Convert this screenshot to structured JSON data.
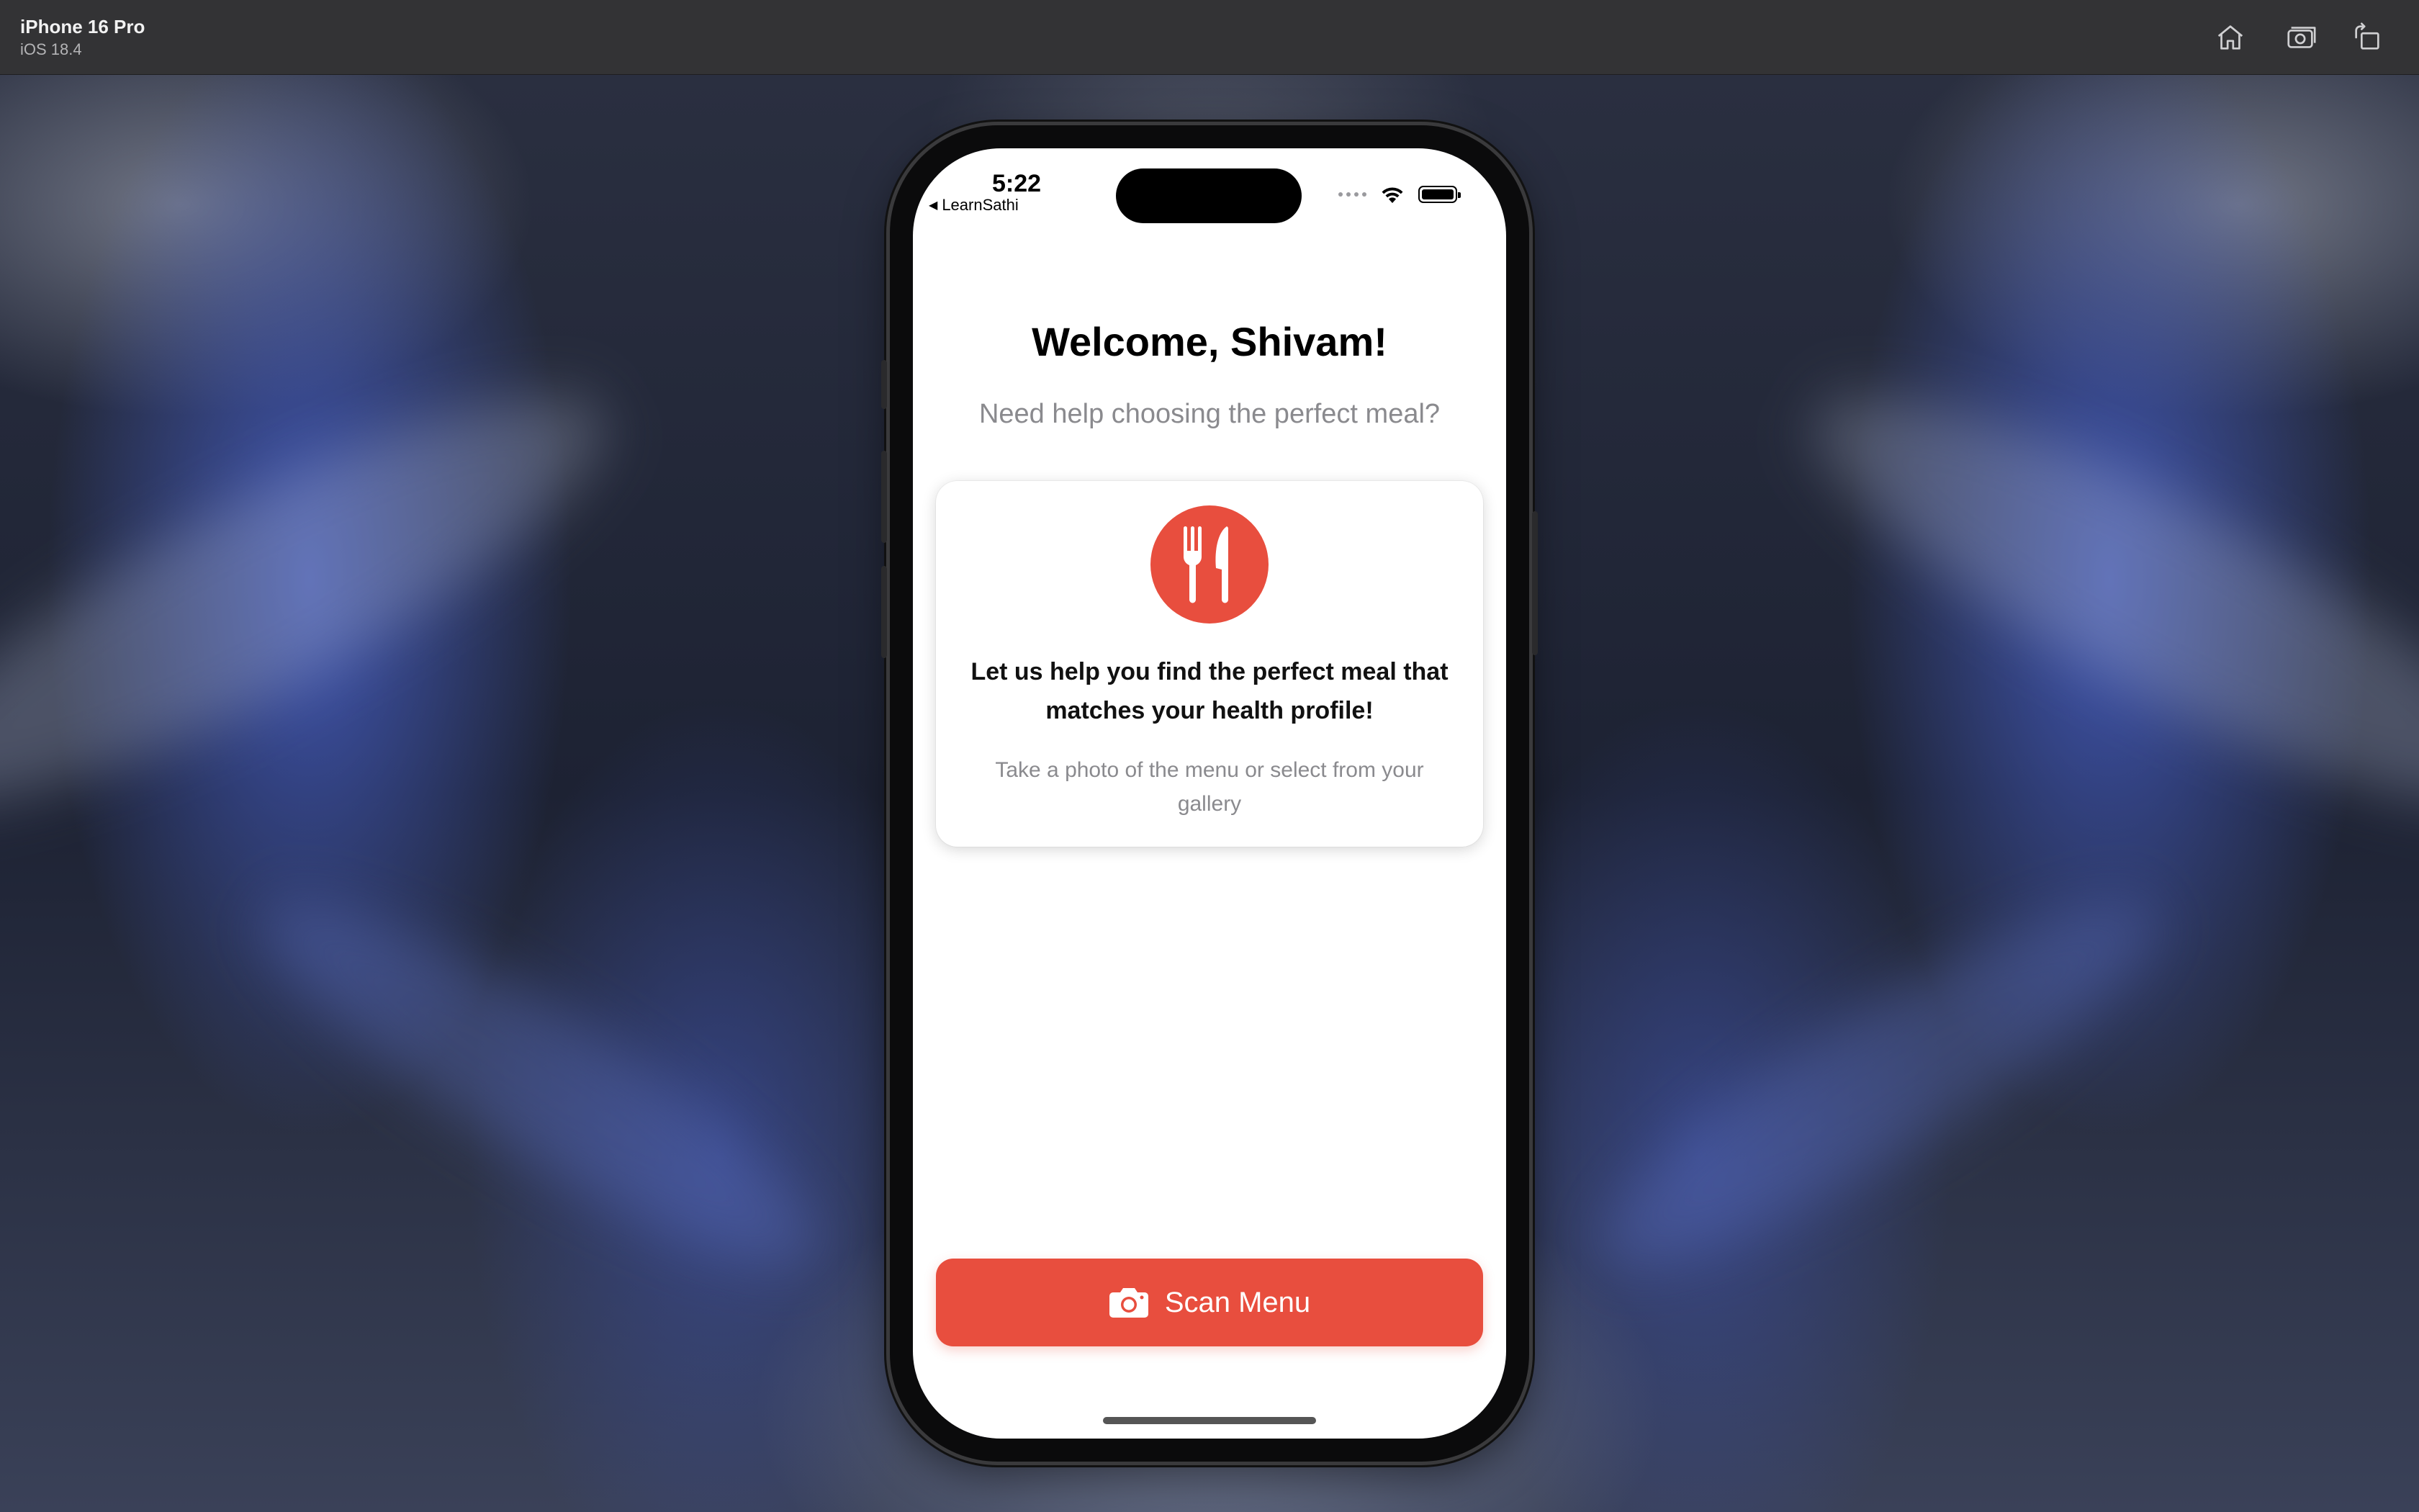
{
  "simulator": {
    "device_name": "iPhone 16 Pro",
    "os_version": "iOS 18.4",
    "toolbar_icons": [
      "home-icon",
      "screenshot-icon",
      "rotate-icon"
    ]
  },
  "status_bar": {
    "time": "5:22",
    "back_app": "LearnSathi",
    "back_caret": "◀"
  },
  "screen": {
    "welcome": "Welcome, Shivam!",
    "subtitle": "Need help choosing the perfect meal?",
    "card": {
      "icon": "fork-knife-icon",
      "title": "Let us help you find the perfect meal that matches your health profile!",
      "description": "Take a photo of the menu or select from your gallery"
    },
    "scan_button": {
      "icon": "camera-icon",
      "label": "Scan Menu"
    }
  },
  "colors": {
    "accent": "#E84E3E",
    "secondary_text": "#8A8A8E",
    "toolbar": "#333335"
  }
}
